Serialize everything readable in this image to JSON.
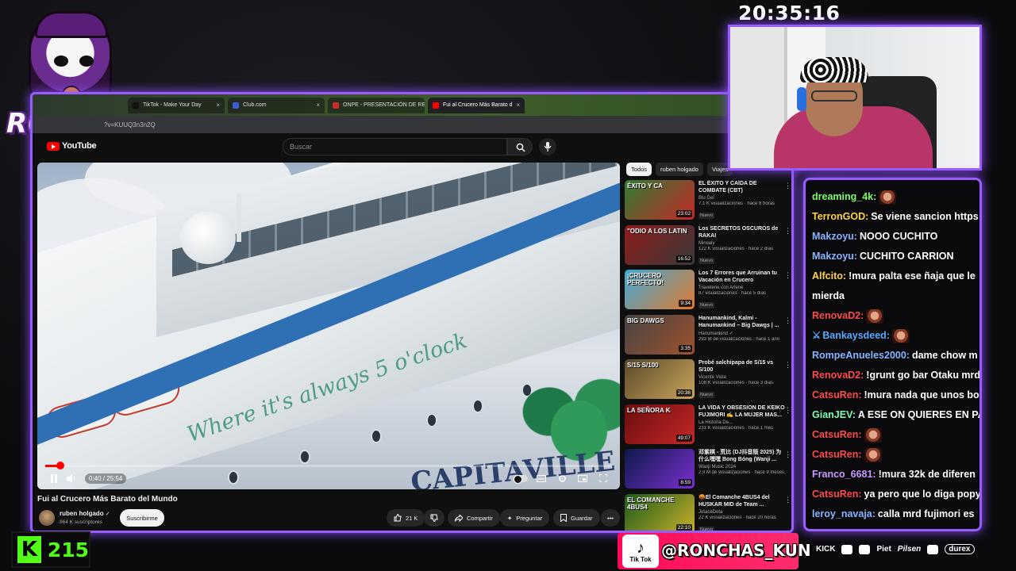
{
  "overlay": {
    "logo_text": "RONCHAS",
    "clock": "20:35:16",
    "kick_count": "215",
    "kick_logo": "K",
    "tiktok_label": "Tik Tok",
    "tiktok_handle": "@RONCHAS_KUN",
    "sponsors": [
      "KICK",
      "Piet",
      "Pilsen",
      "durex"
    ]
  },
  "browser": {
    "tabs": [
      {
        "label": "TikTok - Make Your Day",
        "icon": "tiktok-icon"
      },
      {
        "label": "Club.com",
        "icon": "app-icon"
      },
      {
        "label": "ONPE - PRESENTACIÓN DE RE",
        "icon": "doc-icon"
      },
      {
        "label": "Fui al Crucero Más Barato d",
        "icon": "youtube-icon",
        "active": true
      }
    ],
    "address": "?v=KUUQ3n3n2Q"
  },
  "youtube": {
    "logo": "YouTube",
    "search_placeholder": "Buscar",
    "player": {
      "time": "0:40 / 25:54",
      "progress": 0.026,
      "ship_script": "Where it's always 5 o'clock",
      "ship_name": "CAPITAVILLE"
    },
    "video": {
      "title": "Fui al Crucero Más Barato del Mundo",
      "channel": "ruben holgado",
      "verified": "✓",
      "subscribers": "864 K suscriptores",
      "subscribe_label": "Suscribirme",
      "likes": "21 K",
      "share_label": "Compartir",
      "ask_label": "Preguntar",
      "save_label": "Guardar"
    },
    "chips": [
      "Todos",
      "ruben holgado",
      "Viajes"
    ],
    "recommendations": [
      {
        "title": "EL ÉXITO Y CAÍDA DE COMBATE (CBT)",
        "channel": "Blu Gel",
        "meta": "7,1 K visualizaciones · hace 8 horas",
        "badge": "Nuevo",
        "duration": "23:02",
        "thumb_text": "ÉXITO Y CA",
        "color1": "#2f7d32",
        "color2": "#c62828"
      },
      {
        "title": "Los SECRETOS OSCUROS de RAKAI",
        "channel": "Mirwaly",
        "meta": "122 K visualizaciones · hace 2 días",
        "badge": "Nuevo",
        "duration": "16:52",
        "thumb_text": "\"ODIO A LOS LATIN",
        "color1": "#8e1b1b",
        "color2": "#3a3a3a"
      },
      {
        "title": "Los 7 Errores que Arruinan tu Vacación en Crucero",
        "channel": "Travelene con Arlene",
        "meta": "87 visualizaciones · hace 5 días",
        "badge": "Nuevo",
        "duration": "9:34",
        "thumb_text": "¡CRUCERO PERFECTO!",
        "color1": "#3fa9d6",
        "color2": "#e07a2f"
      },
      {
        "title": "Hanumankind, Kalmi - Hanumankind – Big Dawgs | ...",
        "channel": "Hanumankind ✓",
        "meta": "293 M de visualizaciones · hace 1 año",
        "badge": "",
        "duration": "3:35",
        "thumb_text": "BIG DAWGS",
        "color1": "#444",
        "color2": "#a0522d"
      },
      {
        "title": "Probé salchipapa de S/15 vs S/100",
        "channel": "Vicente Viola",
        "meta": "108 K visualizaciones · hace 3 días",
        "badge": "Nuevo",
        "duration": "20:36",
        "thumb_text": "S/15      S/100",
        "color1": "#5a4a2a",
        "color2": "#c9a45a"
      },
      {
        "title": "LA VIDA Y OBSESIÓN DE KEIKO FUJIMORI ✍ LA MUJER MAS...",
        "channel": "La Historia De...",
        "meta": "231 K visualizaciones · hace 1 mes",
        "badge": "",
        "duration": "49:07",
        "thumb_text": "LA SEÑORA K",
        "color1": "#6a0d0d",
        "color2": "#c62828"
      },
      {
        "title": "邓紫棋 - 荒比 (DJ抖音版 2025) 为什么嘿嘿 Bong Bóng (Wanji ...",
        "channel": "Wanji Music 2024",
        "meta": "2,9 M de visualizaciones · hace 9 meses",
        "badge": "",
        "duration": "8:59",
        "thumb_text": "",
        "color1": "#0d1a4a",
        "color2": "#7a2fd0"
      },
      {
        "title": "🤬El Comanche 4BUS4 del HUSKAR MID de Team ...",
        "channel": "JotaceDota",
        "meta": "22 K visualizaciones · hace 20 horas",
        "badge": "Nuevo",
        "duration": "22:10",
        "thumb_text": "EL COMANCHE 4BUS4",
        "color1": "#1a5a1a",
        "color2": "#c9b02a"
      }
    ]
  },
  "chat": {
    "messages": [
      {
        "user": "dreaming_4k:",
        "text": "",
        "color": "#7cfc6a",
        "emote": true
      },
      {
        "user": "TerronGOD:",
        "text": "Se viene sancion https",
        "color": "#ffd24a"
      },
      {
        "user": "Makzoyu:",
        "text": "NOOO CUCHITO",
        "color": "#8ab4ff"
      },
      {
        "user": "Makzoyu:",
        "text": "CUCHITO CARRION",
        "color": "#8ab4ff"
      },
      {
        "user": "Alfcito:",
        "text": "!mura palta ese ñaja que le",
        "color": "#ffd24a"
      },
      {
        "user": "",
        "text": "mierda",
        "color": "#ffffff"
      },
      {
        "user": "RenovaD2:",
        "text": "",
        "color": "#ff4a4a",
        "emote": true
      },
      {
        "user": "Bankaysdeed:",
        "text": "",
        "color": "#5aa9ff",
        "emote": true,
        "mod": true
      },
      {
        "user": "RompeAnueles2000:",
        "text": "dame chow m",
        "color": "#8ab4ff"
      },
      {
        "user": "RenovaD2:",
        "text": "!grunt go bar Otaku mrd",
        "color": "#ff4a4a"
      },
      {
        "user": "CatsuRen:",
        "text": "!mura nada que unos bo",
        "color": "#ff4a4a"
      },
      {
        "user": "GianJEV:",
        "text": "A ESE ON QUIERES EN PA",
        "color": "#7cfcb0"
      },
      {
        "user": "CatsuRen:",
        "text": "",
        "color": "#ff4a4a",
        "emote": true
      },
      {
        "user": "CatsuRen:",
        "text": "",
        "color": "#ff4a4a",
        "emote": true
      },
      {
        "user": "Franco_6681:",
        "text": "!mura 32k de diferen",
        "color": "#c89bff"
      },
      {
        "user": "CatsuRen:",
        "text": "ya pero que lo diga popy",
        "color": "#ff4a4a"
      },
      {
        "user": "leroy_navaja:",
        "text": "calla mrd fujimori es",
        "color": "#8ab4ff"
      }
    ]
  }
}
